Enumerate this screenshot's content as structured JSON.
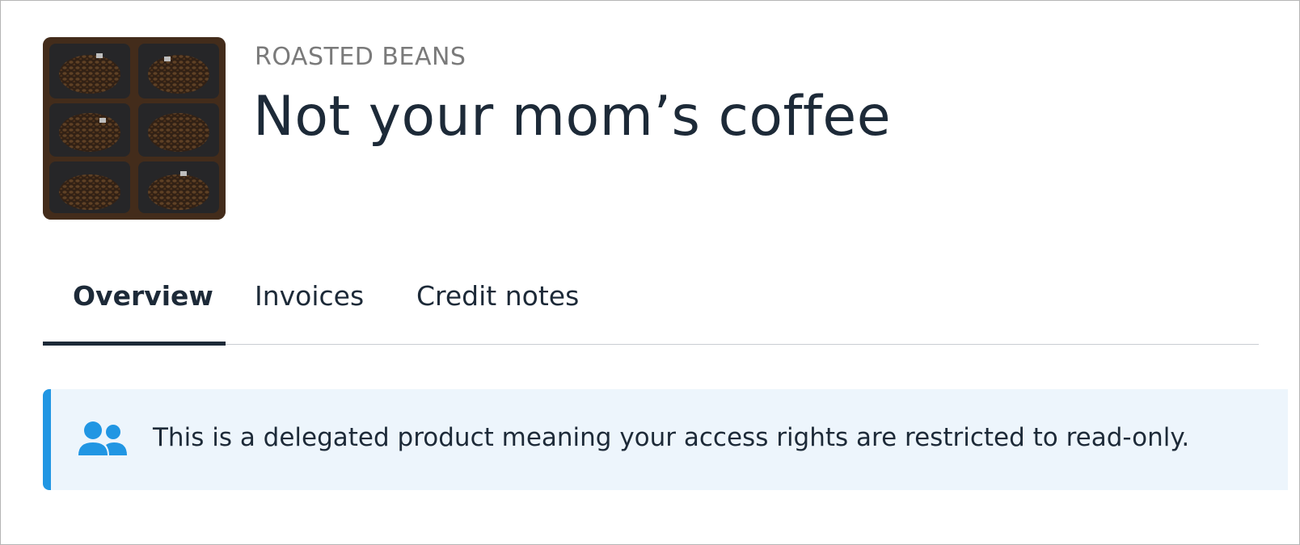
{
  "product": {
    "category": "ROASTED BEANS",
    "title": "Not your mom’s coffee",
    "image_icon": "coffee-bags-photo"
  },
  "tabs": [
    {
      "label": "Overview",
      "active": true
    },
    {
      "label": "Invoices",
      "active": false
    },
    {
      "label": "Credit notes",
      "active": false
    }
  ],
  "notice": {
    "icon": "users-icon",
    "text": "This is a delegated product meaning your access rights are restricted to read-only."
  },
  "colors": {
    "accent": "#2196e3",
    "notice_bg": "#edf5fc",
    "text_dark": "#1d2a38",
    "eyebrow": "#7a7a7a"
  }
}
